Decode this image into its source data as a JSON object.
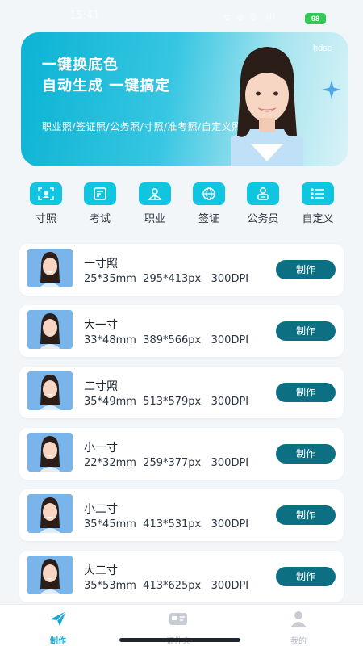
{
  "status_bar": {
    "time": "15:41",
    "signal_text": "ᯤ ⊕ ⊙ .ıll",
    "battery": "98"
  },
  "banner": {
    "line1": "一键换底色",
    "line2": "自动生成 一键搞定",
    "subtitle": "职业照/签证照/公务照/寸照/准考照/自定义照片",
    "brand": "hdsc"
  },
  "categories": [
    {
      "label": "寸照",
      "icon": "id-photo-icon"
    },
    {
      "label": "考试",
      "icon": "exam-icon"
    },
    {
      "label": "职业",
      "icon": "profession-icon"
    },
    {
      "label": "签证",
      "icon": "globe-icon"
    },
    {
      "label": "公务员",
      "icon": "civil-servant-icon"
    },
    {
      "label": "自定义",
      "icon": "custom-list-icon"
    }
  ],
  "sizes": [
    {
      "title": "一寸照",
      "spec": "25*35mm  295*413px   300DPI",
      "button": "制作"
    },
    {
      "title": "大一寸",
      "spec": "33*48mm  389*566px   300DPI",
      "button": "制作"
    },
    {
      "title": "二寸照",
      "spec": "35*49mm  513*579px   300DPI",
      "button": "制作"
    },
    {
      "title": "小一寸",
      "spec": "22*32mm  259*377px   300DPI",
      "button": "制作"
    },
    {
      "title": "小二寸",
      "spec": "35*45mm  413*531px   300DPI",
      "button": "制作"
    },
    {
      "title": "大二寸",
      "spec": "35*53mm  413*625px   300DPI",
      "button": "制作"
    }
  ],
  "tabbar": [
    {
      "label": "制作",
      "icon": "plane-icon",
      "active": true
    },
    {
      "label": "证件夹",
      "icon": "id-card-icon",
      "active": false
    },
    {
      "label": "我的",
      "icon": "user-icon",
      "active": false
    }
  ],
  "colors": {
    "accent": "#10c5e0",
    "button": "#0d6f82",
    "active_tab": "#13a8d6",
    "photo_bg": "#79b4ea"
  }
}
